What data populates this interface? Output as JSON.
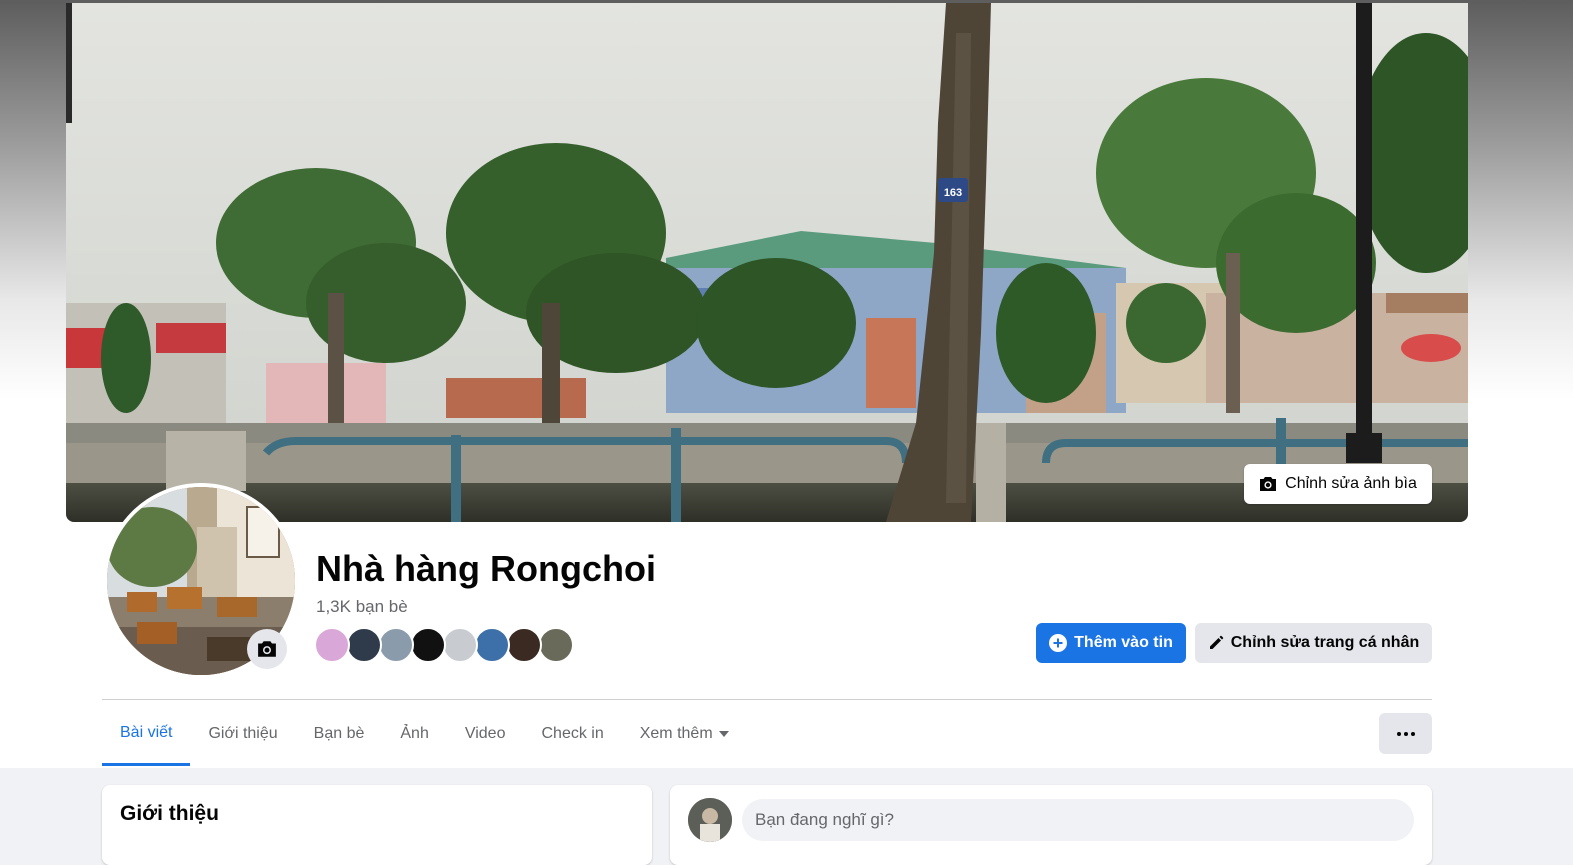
{
  "cover": {
    "edit_label": "Chỉnh sửa ảnh bìa",
    "edit_icon": "camera-icon",
    "street_sign": "163"
  },
  "profile": {
    "name": "Nhà hàng Rongchoi",
    "friends_count": "1,3K bạn bè",
    "avatar_camera_icon": "camera-icon"
  },
  "friend_avatars": [
    {
      "color": "#d9a8d8"
    },
    {
      "color": "#2f3b4a"
    },
    {
      "color": "#8a9cab"
    },
    {
      "color": "#111111"
    },
    {
      "color": "#c8ccd1"
    },
    {
      "color": "#3d6fa8"
    },
    {
      "color": "#3a2a22"
    },
    {
      "color": "#6a6a5a"
    }
  ],
  "actions": {
    "add_story_label": "Thêm vào tin",
    "add_story_icon": "plus-circle-icon",
    "edit_profile_label": "Chỉnh sửa trang cá nhân",
    "edit_profile_icon": "pencil-icon"
  },
  "tabs": [
    {
      "label": "Bài viết",
      "active": true
    },
    {
      "label": "Giới thiệu",
      "active": false
    },
    {
      "label": "Bạn bè",
      "active": false
    },
    {
      "label": "Ảnh",
      "active": false
    },
    {
      "label": "Video",
      "active": false
    },
    {
      "label": "Check in",
      "active": false
    },
    {
      "label": "Xem thêm",
      "active": false,
      "dropdown": true
    }
  ],
  "more_menu_icon": "ellipsis-icon",
  "intro": {
    "title": "Giới thiệu"
  },
  "composer": {
    "placeholder": "Bạn đang nghĩ gì?"
  },
  "colors": {
    "accent": "#1b74e4",
    "secondary_button": "#e4e6eb",
    "page_background": "#f0f2f5",
    "muted_text": "#65676b"
  }
}
